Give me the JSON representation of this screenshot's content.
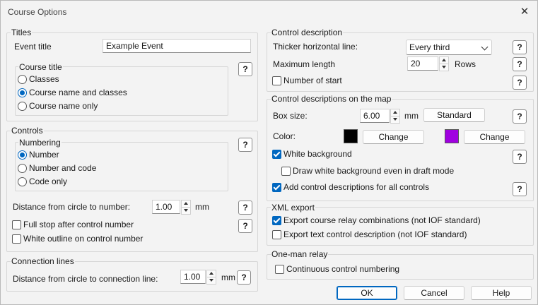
{
  "window": {
    "title": "Course Options"
  },
  "titles": {
    "group_label": "Titles",
    "event_title_label": "Event title",
    "event_title_value": "Example Event",
    "course_title": {
      "group_label": "Course title",
      "options": [
        "Classes",
        "Course name and classes",
        "Course name only"
      ],
      "selected": "Course name and classes"
    }
  },
  "controls": {
    "group_label": "Controls",
    "numbering": {
      "group_label": "Numbering",
      "options": [
        "Number",
        "Number and code",
        "Code only"
      ],
      "selected": "Number"
    },
    "distance_label": "Distance from circle to number:",
    "distance_value": "1.00",
    "distance_unit": "mm",
    "full_stop_label": "Full stop after control number",
    "full_stop_checked": false,
    "white_outline_label": "White outline on control number",
    "white_outline_checked": false
  },
  "connection_lines": {
    "group_label": "Connection lines",
    "distance_label": "Distance from circle to connection line:",
    "distance_value": "1.00",
    "distance_unit": "mm"
  },
  "control_description": {
    "group_label": "Control description",
    "thicker_label": "Thicker horizontal line:",
    "thicker_value": "Every third",
    "max_length_label": "Maximum length",
    "max_length_value": "20",
    "max_length_unit": "Rows",
    "number_of_start_label": "Number of start",
    "number_of_start_checked": false
  },
  "descriptions_on_map": {
    "group_label": "Control descriptions on the map",
    "box_size_label": "Box size:",
    "box_size_value": "6.00",
    "box_size_unit": "mm",
    "standard_button": "Standard",
    "color_label": "Color:",
    "color1": "#000000",
    "color2": "#a000e0",
    "change_button": "Change",
    "white_bg_label": "White background",
    "white_bg_checked": true,
    "draft_mode_label": "Draw white background even in draft mode",
    "draft_mode_checked": false,
    "all_controls_label": "Add control descriptions for all controls",
    "all_controls_checked": true
  },
  "xml_export": {
    "group_label": "XML export",
    "relay_label": "Export course relay combinations (not IOF standard)",
    "relay_checked": true,
    "text_desc_label": "Export text control description (not IOF standard)",
    "text_desc_checked": false
  },
  "one_man_relay": {
    "group_label": "One-man relay",
    "continuous_label": "Continuous control numbering",
    "continuous_checked": false
  },
  "help_glyph": "?",
  "buttons": {
    "ok": "OK",
    "cancel": "Cancel",
    "help": "Help"
  },
  "accent_color": "#0067c0"
}
